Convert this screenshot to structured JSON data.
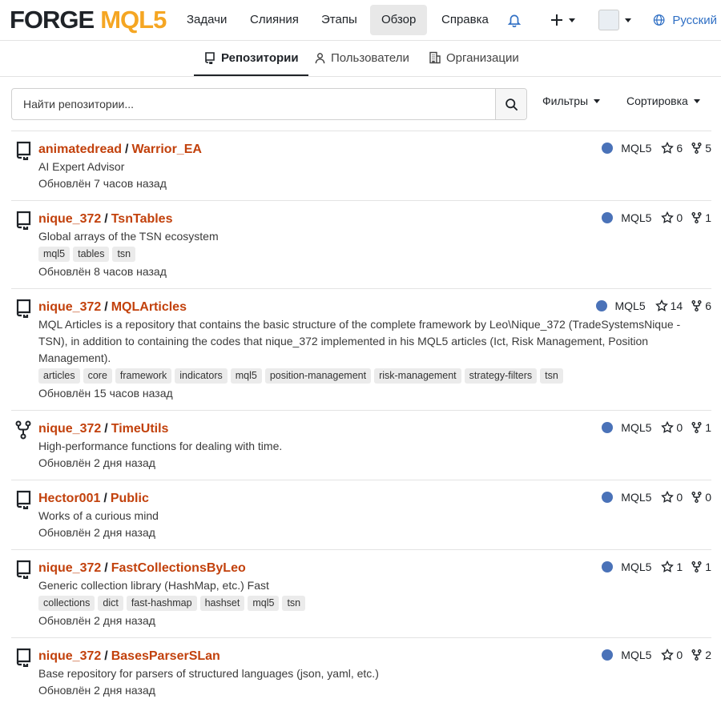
{
  "nav": {
    "logo": {
      "forge": "FORGE",
      "mql5": "MQL5"
    },
    "items": [
      "Задачи",
      "Слияния",
      "Этапы",
      "Обзор",
      "Справка"
    ],
    "active": "Обзор",
    "language": "Русский"
  },
  "tabs": [
    {
      "label": "Репозитории",
      "icon": "repo-icon",
      "active": true
    },
    {
      "label": "Пользователи",
      "icon": "user-icon",
      "active": false
    },
    {
      "label": "Организации",
      "icon": "organization-icon",
      "active": false
    }
  ],
  "search": {
    "placeholder": "Найти репозитории...",
    "value": ""
  },
  "filters_label": "Фильтры",
  "sort_label": "Сортировка",
  "accent": "#c2410c",
  "language_color": "#4a72b8",
  "repos": [
    {
      "owner": "animatedread",
      "name": "Warrior_EA",
      "description": "AI Expert Advisor",
      "topics": [],
      "updated": "Обновлён 7 часов назад",
      "language": "MQL5",
      "stars": "6",
      "forks": "5",
      "icon": "repo-icon"
    },
    {
      "owner": "nique_372",
      "name": "TsnTables",
      "description": "Global arrays of the TSN ecosystem",
      "topics": [
        "mql5",
        "tables",
        "tsn"
      ],
      "updated": "Обновлён 8 часов назад",
      "language": "MQL5",
      "stars": "0",
      "forks": "1",
      "icon": "repo-icon"
    },
    {
      "owner": "nique_372",
      "name": "MQLArticles",
      "description": "MQL Articles is a repository that contains the basic structure of the complete framework by Leo\\Nique_372 (TradeSystemsNique - TSN), in addition to containing the codes that nique_372 implemented in his MQL5 articles (Ict, Risk Management, Position Management).",
      "topics": [
        "articles",
        "core",
        "framework",
        "indicators",
        "mql5",
        "position-management",
        "risk-management",
        "strategy-filters",
        "tsn"
      ],
      "updated": "Обновлён 15 часов назад",
      "language": "MQL5",
      "stars": "14",
      "forks": "6",
      "icon": "repo-icon"
    },
    {
      "owner": "nique_372",
      "name": "TimeUtils",
      "description": "High-performance functions for dealing with time.",
      "topics": [],
      "updated": "Обновлён 2 дня назад",
      "language": "MQL5",
      "stars": "0",
      "forks": "1",
      "icon": "fork-icon"
    },
    {
      "owner": "Hector001",
      "name": "Public",
      "description": "Works of a curious mind",
      "topics": [],
      "updated": "Обновлён 2 дня назад",
      "language": "MQL5",
      "stars": "0",
      "forks": "0",
      "icon": "repo-icon"
    },
    {
      "owner": "nique_372",
      "name": "FastCollectionsByLeo",
      "description": "Generic collection library (HashMap, etc.) Fast",
      "topics": [
        "collections",
        "dict",
        "fast-hashmap",
        "hashset",
        "mql5",
        "tsn"
      ],
      "updated": "Обновлён 2 дня назад",
      "language": "MQL5",
      "stars": "1",
      "forks": "1",
      "icon": "repo-icon"
    },
    {
      "owner": "nique_372",
      "name": "BasesParserSLan",
      "description": "Base repository for parsers of structured languages (json, yaml, etc.)",
      "topics": [],
      "updated": "Обновлён 2 дня назад",
      "language": "MQL5",
      "stars": "0",
      "forks": "2",
      "icon": "repo-icon"
    }
  ]
}
